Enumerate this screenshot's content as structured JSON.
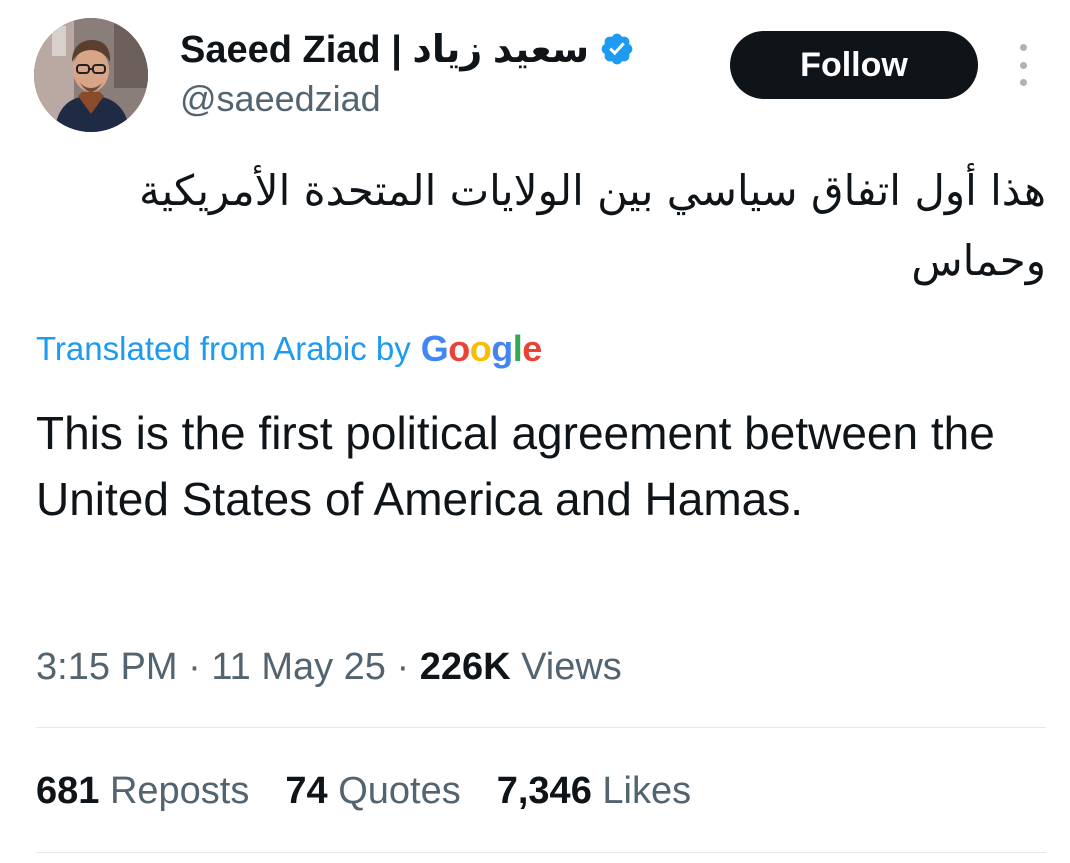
{
  "author": {
    "display_name": "Saeed Ziad | سعيد زياد",
    "handle": "@saeedziad",
    "verified_icon": "verified-badge-icon",
    "verified_color": "#1d9bf0"
  },
  "actions": {
    "follow_label": "Follow",
    "more_icon": "more-vertical-icon"
  },
  "tweet": {
    "original_text": "هذا أول اتفاق سياسي بين الولايات المتحدة الأمريكية وحماس",
    "translation_label": "Translated from Arabic by",
    "translation_provider": {
      "letters": [
        "G",
        "o",
        "o",
        "g",
        "l",
        "e"
      ],
      "colors": [
        "#4285f4",
        "#ea4335",
        "#fbbc05",
        "#4285f4",
        "#34a853",
        "#ea4335"
      ]
    },
    "translated_text": "This is the first political agreement between the United States of America and Hamas."
  },
  "meta": {
    "time": "3:15 PM",
    "separator": " · ",
    "date": "11 May 25",
    "views_count": "226K",
    "views_label": " Views"
  },
  "stats": [
    {
      "count": "681",
      "label": " Reposts"
    },
    {
      "count": "74",
      "label": " Quotes"
    },
    {
      "count": "7,346",
      "label": " Likes"
    }
  ],
  "colors": {
    "text_primary": "#0f1419",
    "text_secondary": "#536471",
    "accent": "#1d9bf0",
    "button_bg": "#0f1419",
    "divider": "#e6e9eb"
  }
}
